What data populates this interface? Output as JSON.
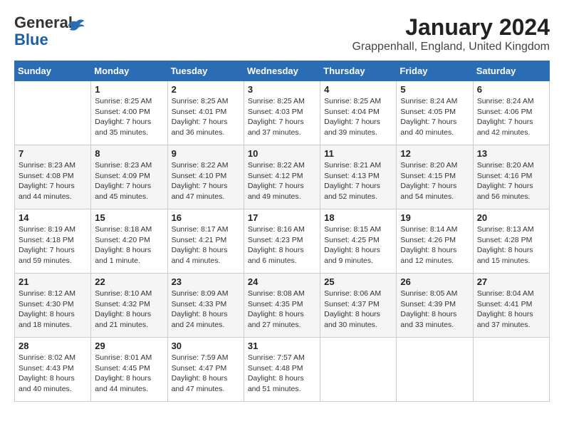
{
  "logo": {
    "general": "General",
    "blue": "Blue"
  },
  "title": "January 2024",
  "location": "Grappenhall, England, United Kingdom",
  "days_of_week": [
    "Sunday",
    "Monday",
    "Tuesday",
    "Wednesday",
    "Thursday",
    "Friday",
    "Saturday"
  ],
  "weeks": [
    [
      {
        "day": "",
        "info": ""
      },
      {
        "day": "1",
        "info": "Sunrise: 8:25 AM\nSunset: 4:00 PM\nDaylight: 7 hours\nand 35 minutes."
      },
      {
        "day": "2",
        "info": "Sunrise: 8:25 AM\nSunset: 4:01 PM\nDaylight: 7 hours\nand 36 minutes."
      },
      {
        "day": "3",
        "info": "Sunrise: 8:25 AM\nSunset: 4:03 PM\nDaylight: 7 hours\nand 37 minutes."
      },
      {
        "day": "4",
        "info": "Sunrise: 8:25 AM\nSunset: 4:04 PM\nDaylight: 7 hours\nand 39 minutes."
      },
      {
        "day": "5",
        "info": "Sunrise: 8:24 AM\nSunset: 4:05 PM\nDaylight: 7 hours\nand 40 minutes."
      },
      {
        "day": "6",
        "info": "Sunrise: 8:24 AM\nSunset: 4:06 PM\nDaylight: 7 hours\nand 42 minutes."
      }
    ],
    [
      {
        "day": "7",
        "info": "Sunrise: 8:23 AM\nSunset: 4:08 PM\nDaylight: 7 hours\nand 44 minutes."
      },
      {
        "day": "8",
        "info": "Sunrise: 8:23 AM\nSunset: 4:09 PM\nDaylight: 7 hours\nand 45 minutes."
      },
      {
        "day": "9",
        "info": "Sunrise: 8:22 AM\nSunset: 4:10 PM\nDaylight: 7 hours\nand 47 minutes."
      },
      {
        "day": "10",
        "info": "Sunrise: 8:22 AM\nSunset: 4:12 PM\nDaylight: 7 hours\nand 49 minutes."
      },
      {
        "day": "11",
        "info": "Sunrise: 8:21 AM\nSunset: 4:13 PM\nDaylight: 7 hours\nand 52 minutes."
      },
      {
        "day": "12",
        "info": "Sunrise: 8:20 AM\nSunset: 4:15 PM\nDaylight: 7 hours\nand 54 minutes."
      },
      {
        "day": "13",
        "info": "Sunrise: 8:20 AM\nSunset: 4:16 PM\nDaylight: 7 hours\nand 56 minutes."
      }
    ],
    [
      {
        "day": "14",
        "info": "Sunrise: 8:19 AM\nSunset: 4:18 PM\nDaylight: 7 hours\nand 59 minutes."
      },
      {
        "day": "15",
        "info": "Sunrise: 8:18 AM\nSunset: 4:20 PM\nDaylight: 8 hours\nand 1 minute."
      },
      {
        "day": "16",
        "info": "Sunrise: 8:17 AM\nSunset: 4:21 PM\nDaylight: 8 hours\nand 4 minutes."
      },
      {
        "day": "17",
        "info": "Sunrise: 8:16 AM\nSunset: 4:23 PM\nDaylight: 8 hours\nand 6 minutes."
      },
      {
        "day": "18",
        "info": "Sunrise: 8:15 AM\nSunset: 4:25 PM\nDaylight: 8 hours\nand 9 minutes."
      },
      {
        "day": "19",
        "info": "Sunrise: 8:14 AM\nSunset: 4:26 PM\nDaylight: 8 hours\nand 12 minutes."
      },
      {
        "day": "20",
        "info": "Sunrise: 8:13 AM\nSunset: 4:28 PM\nDaylight: 8 hours\nand 15 minutes."
      }
    ],
    [
      {
        "day": "21",
        "info": "Sunrise: 8:12 AM\nSunset: 4:30 PM\nDaylight: 8 hours\nand 18 minutes."
      },
      {
        "day": "22",
        "info": "Sunrise: 8:10 AM\nSunset: 4:32 PM\nDaylight: 8 hours\nand 21 minutes."
      },
      {
        "day": "23",
        "info": "Sunrise: 8:09 AM\nSunset: 4:33 PM\nDaylight: 8 hours\nand 24 minutes."
      },
      {
        "day": "24",
        "info": "Sunrise: 8:08 AM\nSunset: 4:35 PM\nDaylight: 8 hours\nand 27 minutes."
      },
      {
        "day": "25",
        "info": "Sunrise: 8:06 AM\nSunset: 4:37 PM\nDaylight: 8 hours\nand 30 minutes."
      },
      {
        "day": "26",
        "info": "Sunrise: 8:05 AM\nSunset: 4:39 PM\nDaylight: 8 hours\nand 33 minutes."
      },
      {
        "day": "27",
        "info": "Sunrise: 8:04 AM\nSunset: 4:41 PM\nDaylight: 8 hours\nand 37 minutes."
      }
    ],
    [
      {
        "day": "28",
        "info": "Sunrise: 8:02 AM\nSunset: 4:43 PM\nDaylight: 8 hours\nand 40 minutes."
      },
      {
        "day": "29",
        "info": "Sunrise: 8:01 AM\nSunset: 4:45 PM\nDaylight: 8 hours\nand 44 minutes."
      },
      {
        "day": "30",
        "info": "Sunrise: 7:59 AM\nSunset: 4:47 PM\nDaylight: 8 hours\nand 47 minutes."
      },
      {
        "day": "31",
        "info": "Sunrise: 7:57 AM\nSunset: 4:48 PM\nDaylight: 8 hours\nand 51 minutes."
      },
      {
        "day": "",
        "info": ""
      },
      {
        "day": "",
        "info": ""
      },
      {
        "day": "",
        "info": ""
      }
    ]
  ]
}
